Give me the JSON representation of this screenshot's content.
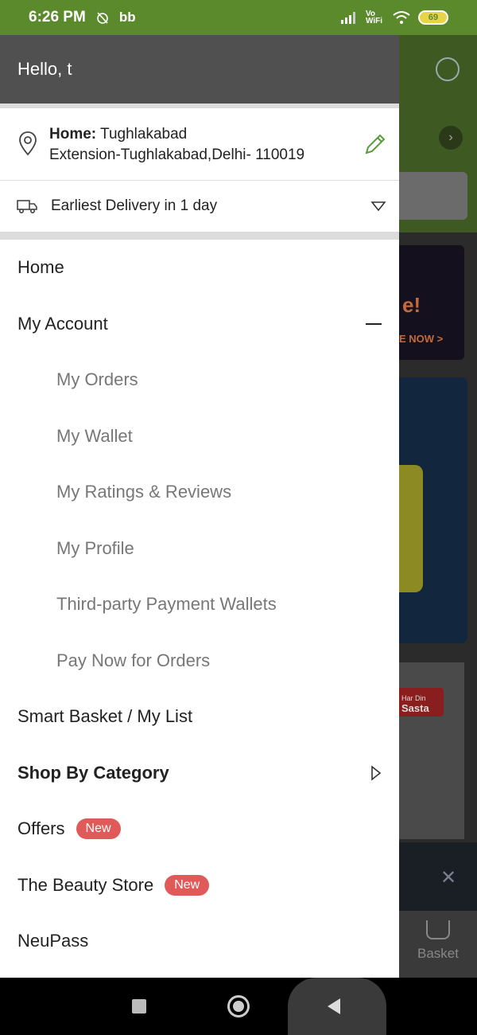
{
  "status_bar": {
    "time": "6:26 PM",
    "battery": "69",
    "network": "Vo WiFi"
  },
  "drawer": {
    "greeting": "Hello, t",
    "address": {
      "label": "Home:",
      "line1": " Tughlakabad",
      "line2": "Extension-Tughlakabad,Delhi- 110019"
    },
    "delivery": "Earliest Delivery in 1 day",
    "menu": {
      "home": "Home",
      "my_account": "My Account",
      "my_orders": "My Orders",
      "my_wallet": "My Wallet",
      "my_ratings": "My Ratings & Reviews",
      "my_profile": "My Profile",
      "third_party_wallets": "Third-party Payment Wallets",
      "pay_now": "Pay Now for Orders",
      "smart_basket": "Smart Basket / My List",
      "shop_by_category": "Shop By Category",
      "offers": "Offers",
      "offers_badge": "New",
      "beauty_store": "The Beauty Store",
      "beauty_badge": "New",
      "neupass": "NeuPass"
    }
  },
  "background": {
    "banner_text": "e!",
    "banner_cta": "E NOW >",
    "card_brand_top": "Har Din",
    "card_brand": "Sasta",
    "basket_label": "Basket"
  },
  "colors": {
    "status_green": "#5b8a2c",
    "badge_red": "#e05a5a",
    "edit_green": "#5a9a3a"
  }
}
